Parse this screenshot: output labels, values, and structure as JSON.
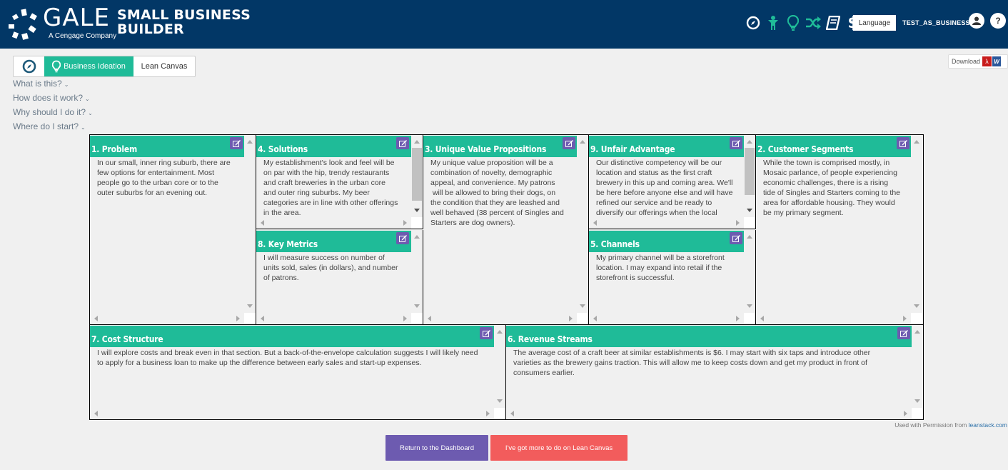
{
  "header": {
    "brand": "GALE",
    "brand_sub": "A Cengage Company",
    "app_title_line1": "SMALL BUSINESS",
    "app_title_line2": "BUILDER",
    "icons": [
      "compass-icon",
      "person-icon",
      "lightbulb-icon",
      "shuffle-icon",
      "book-icon",
      "dollar-icon"
    ],
    "language_label": "Language",
    "username": "TEST_AS_BUSINESS",
    "help_label": "?"
  },
  "tabs": {
    "items": [
      {
        "label": "",
        "icon": "compass-icon"
      },
      {
        "label": "Business Ideation",
        "icon": "lightbulb-icon",
        "active": true
      },
      {
        "label": "Lean Canvas"
      }
    ]
  },
  "faq": [
    {
      "label": "What is this?"
    },
    {
      "label": "How does it work?"
    },
    {
      "label": "Why should I do it?"
    },
    {
      "label": "Where do I start?"
    }
  ],
  "download": {
    "label": "Download"
  },
  "canvas": {
    "problem": {
      "title": "1. Problem",
      "text": "In our small, inner ring suburb, there are\nfew options for entertainment. Most\npeople go to the urban core or to the\nouter suburbs for an evening out."
    },
    "solutions": {
      "title": "4. Solutions",
      "text": "My establishment's look and feel will be\non par with the hip, trendy restaurants\nand craft breweries in the urban core\nand outer ring suburbs. My beer\ncategories are in line with other offerings\nin the area."
    },
    "key_metrics": {
      "title": "8. Key Metrics",
      "text": "I will measure success on number of\nunits sold, sales (in dollars), and number\nof patrons."
    },
    "uvp": {
      "title": "3. Unique Value Propositions",
      "text": "My unique value proposition will be a\ncombination of novelty, demographic\nappeal, and convenience. My patrons\n will be allowed to bring their dogs, on\nthe condition that they are leashed and\nwell behaved (38 percent of Singles and\nStarters are dog owners)."
    },
    "unfair_advantage": {
      "title": "9. Unfair Advantage",
      "text": "Our distinctive competency will be our\nlocation and status as the first craft\nbrewery in this up and coming area. We'll\nbe here before anyone else and will have\nrefined our service and be ready to\ndiversify our offerings when the local"
    },
    "channels": {
      "title": "5. Channels",
      "text": "My primary channel will be a storefront\nlocation. I may expand into retail if the\nstorefront is successful."
    },
    "customer_segments": {
      "title": "2. Customer Segments",
      "text": "While the town is comprised mostly, in\nMosaic parlance, of people experiencing\neconomic challenges, there is a rising\ntide of Singles and Starters coming to the\narea for affordable housing. They would\nbe my primary segment."
    },
    "cost_structure": {
      "title": "7. Cost Structure",
      "text": "I will explore costs and break even in that section. But a back-of-the-envelope calculation suggests I will likely need\nto apply for a business loan to make up the difference between early sales and start-up expenses."
    },
    "revenue_streams": {
      "title": "6. Revenue Streams",
      "text": "The average cost of a craft beer at similar establishments is $6. I may start with six taps and introduce other\nvarieties as the brewery gains traction. This will allow me to keep costs down and get my product in front of\nconsumers earlier."
    }
  },
  "permission": {
    "prefix": "Used with Permission from ",
    "link": "leanstack.com"
  },
  "actions": {
    "dashboard_label": "Return to the Dashboard",
    "more_label": "I've got more to do on Lean Canvas"
  },
  "colors": {
    "header_bg": "#023766",
    "accent_green": "#1fbb98",
    "edit_purple": "#6d5bb0",
    "more_red": "#f25c5c"
  }
}
